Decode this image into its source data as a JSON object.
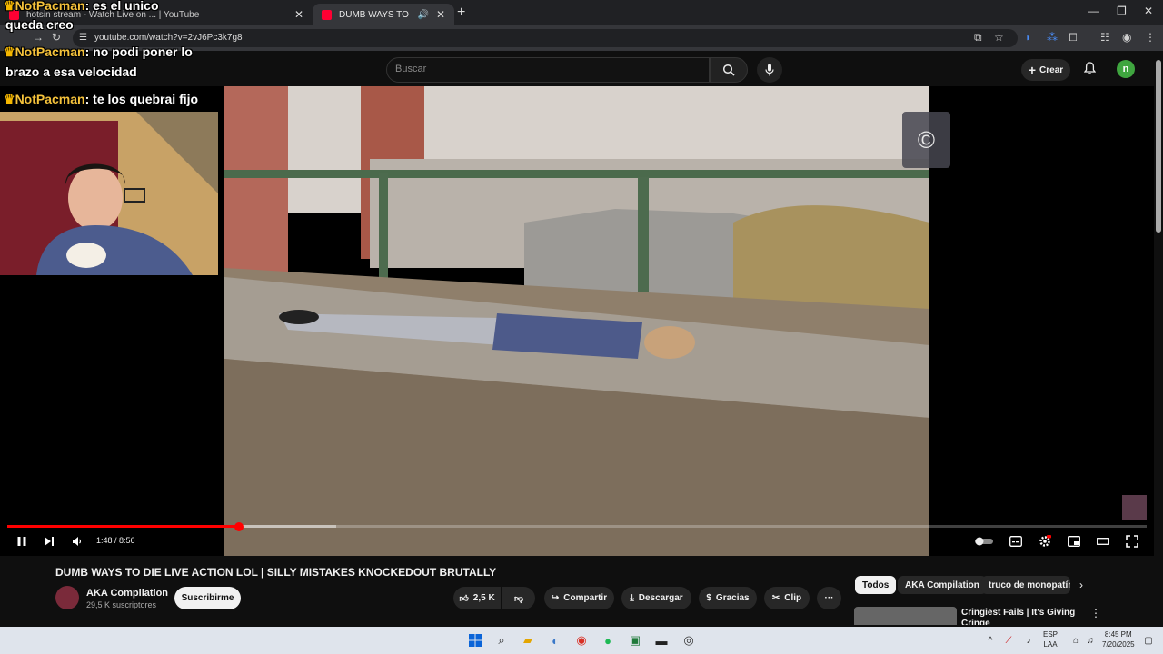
{
  "browser": {
    "tabs": [
      {
        "label": "hotsin stream - Watch Live on ... | YouTube"
      },
      {
        "label": "DUMB WAYS TO DIE LIVE A"
      }
    ],
    "url": "youtube.com/watch?v=2vJ6Pc3k7g8"
  },
  "header": {
    "search_placeholder": "Buscar",
    "create_label": "Crear",
    "avatar_letter": "n"
  },
  "chat": [
    {
      "user": "NotPacman",
      "text": "es el unico"
    },
    {
      "user": "",
      "text": "queda creo"
    },
    {
      "user": "NotPacman",
      "text": "no podi poner lo"
    },
    {
      "user": "",
      "text": "brazo a esa velocidad"
    },
    {
      "user": "NotPacman",
      "text": "te los quebrai fijo"
    }
  ],
  "player": {
    "time": "1:48 / 8:56",
    "progress": 0.203,
    "buffered": 0.289
  },
  "video": {
    "title": "DUMB WAYS TO DIE LIVE ACTION LOL | SILLY MISTAKES KNOCKEDOUT BRUTALLY",
    "channel": "AKA Compilation",
    "subscribers": "29,5 K suscriptores",
    "subscribe_label": "Suscribirme",
    "likes": "2,5 K",
    "share_label": "Compartir",
    "download_label": "Descargar",
    "thanks_label": "Gracias",
    "clip_label": "Clip"
  },
  "chips": [
    "Todos",
    "AKA Compilation",
    "truco de monopatín"
  ],
  "recommendation": {
    "title": "Cringiest Fails | It's Giving Cringe"
  },
  "taskbar": {
    "lang_1": "ESP",
    "lang_2": "LAA",
    "time": "8:45 PM",
    "date": "7/20/2025"
  },
  "colors": {
    "accent": "#ff0000",
    "background": "#0f0f0f"
  }
}
